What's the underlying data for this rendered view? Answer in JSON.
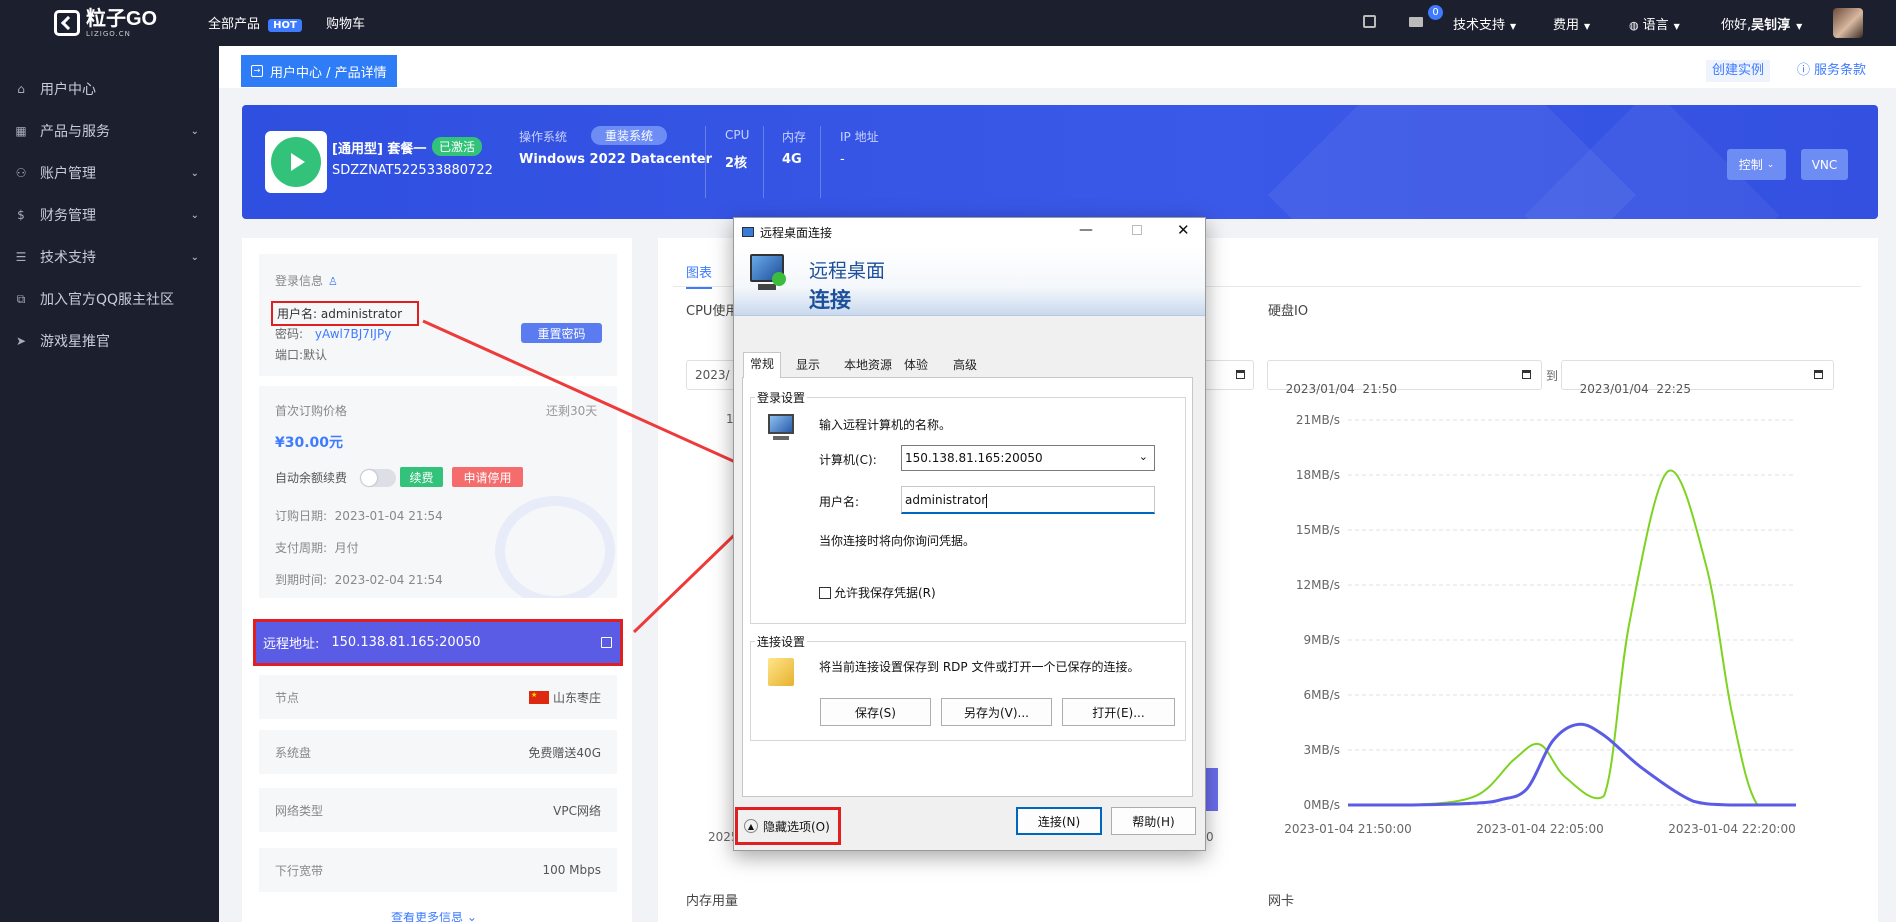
{
  "topbar": {
    "logo_text": "粒子GO",
    "logo_sub": "LIZIGO.CN",
    "nav_all_products": "全部产品",
    "hot_badge": "HOT",
    "nav_cart": "购物车",
    "mail_count": "0",
    "tech_support": "技术支持",
    "fees": "费用",
    "language": "语言",
    "greeting": "你好,",
    "username": "吴钊淳"
  },
  "sidebar": {
    "items": [
      {
        "label": "用户中心",
        "icon": "home-icon"
      },
      {
        "label": "产品与服务",
        "icon": "grid-icon"
      },
      {
        "label": "账户管理",
        "icon": "user-icon"
      },
      {
        "label": "财务管理",
        "icon": "dollar-icon"
      },
      {
        "label": "技术支持",
        "icon": "doc-icon"
      },
      {
        "label": "加入官方QQ服主社区",
        "icon": "share-icon"
      },
      {
        "label": "游戏星推官",
        "icon": "send-icon"
      }
    ]
  },
  "breadcrumb": {
    "text": "用户中心 / 产品详情",
    "create_instance": "创建实例",
    "terms": "服务条款"
  },
  "banner": {
    "plan": "[通用型] 套餐一",
    "status": "已激活",
    "product_id": "SDZZNAT522533880722",
    "os_label": "操作系统",
    "reinstall": "重装系统",
    "os_value": "Windows 2022 Datacenter",
    "cpu_label": "CPU",
    "cpu_value": "2核",
    "mem_label": "内存",
    "mem_value": "4G",
    "ip_label": "IP 地址",
    "ip_value": "-",
    "control": "控制",
    "vnc": "VNC"
  },
  "login": {
    "title": "登录信息",
    "username_label": "用户名:",
    "username": "administrator",
    "password_label": "密码:",
    "password": "yAwl7BJ7IJPy",
    "port_label": "端口:",
    "port": "默认",
    "reset_password": "重置密码"
  },
  "billing": {
    "first_price_label": "首次订购价格",
    "remaining": "还剩30天",
    "price": "¥30.00元",
    "auto_renew_label": "自动余额续费",
    "auto_renew_on": false,
    "renew": "续费",
    "request_stop": "申请停用",
    "order_date": "订购日期:  2023-01-04 21:54",
    "pay_cycle": "支付周期:  月付",
    "expire": "到期时间:  2023-02-04 21:54"
  },
  "remote": {
    "label": "远程地址:",
    "address": "150.138.81.165:20050"
  },
  "details": [
    {
      "label": "节点",
      "value": "山东枣庄"
    },
    {
      "label": "系统盘",
      "value": "免费赠送40G"
    },
    {
      "label": "网络类型",
      "value": "VPC网络"
    },
    {
      "label": "下行宽带",
      "value": "100 Mbps"
    }
  ],
  "more_info": "查看更多信息",
  "charts_panel": {
    "tab_chart": "图表",
    "cpu_title": "CPU使用",
    "disk_title": "硬盘IO",
    "mem_title": "内存用量",
    "nic_title": "网卡",
    "date_from_left": "2023/",
    "date_from": "2023/01/04  21:50",
    "to": "到",
    "date_to": "2023/01/04  22:25",
    "left_axis_fragment": "1",
    "left_x_fragment": "2025",
    "left_x_fragment2": "0"
  },
  "chart_data": {
    "type": "line",
    "title": "硬盘IO",
    "xlabel": "",
    "ylabel": "",
    "x_ticks": [
      "2023-01-04 21:50:00",
      "2023-01-04 22:05:00",
      "2023-01-04 22:20:00"
    ],
    "y_ticks": [
      "0MB/s",
      "3MB/s",
      "6MB/s",
      "9MB/s",
      "12MB/s",
      "15MB/s",
      "18MB/s",
      "21MB/s"
    ],
    "ylim": [
      0,
      21
    ],
    "xlim": [
      0,
      35
    ],
    "grid": true,
    "series": [
      {
        "color": "#7ed321",
        "x": [
          0,
          5,
          10,
          13,
          15,
          17,
          20,
          22,
          25,
          28,
          30,
          32,
          35
        ],
        "y": [
          0,
          0,
          0.5,
          2.5,
          3.3,
          1.5,
          0.5,
          10,
          18.2,
          13,
          5,
          0,
          0
        ]
      },
      {
        "color": "#5b5ce6",
        "x": [
          0,
          5,
          10,
          12,
          14,
          16,
          18,
          20,
          23,
          27,
          30,
          35
        ],
        "y": [
          0,
          0,
          0.1,
          0.3,
          0.9,
          3.5,
          4.4,
          3.8,
          2.0,
          0.2,
          0,
          0
        ]
      }
    ]
  },
  "rdp": {
    "window_title": "远程桌面连接",
    "header_line1": "远程桌面",
    "header_line2": "连接",
    "tabs": [
      "常规",
      "显示",
      "本地资源",
      "体验",
      "高级"
    ],
    "login_group": "登录设置",
    "enter_name": "输入远程计算机的名称。",
    "computer_label": "计算机(C):",
    "computer_value": "150.138.81.165:20050",
    "user_label": "用户名:",
    "user_value": "administrator",
    "credential_note": "当你连接时将向你询问凭据。",
    "allow_save": "允许我保存凭据(R)",
    "conn_group": "连接设置",
    "conn_note": "将当前连接设置保存到 RDP 文件或打开一个已保存的连接。",
    "save": "保存(S)",
    "save_as": "另存为(V)...",
    "open": "打开(E)...",
    "hide_options": "隐藏选项(O)",
    "connect": "连接(N)",
    "help": "帮助(H)"
  }
}
